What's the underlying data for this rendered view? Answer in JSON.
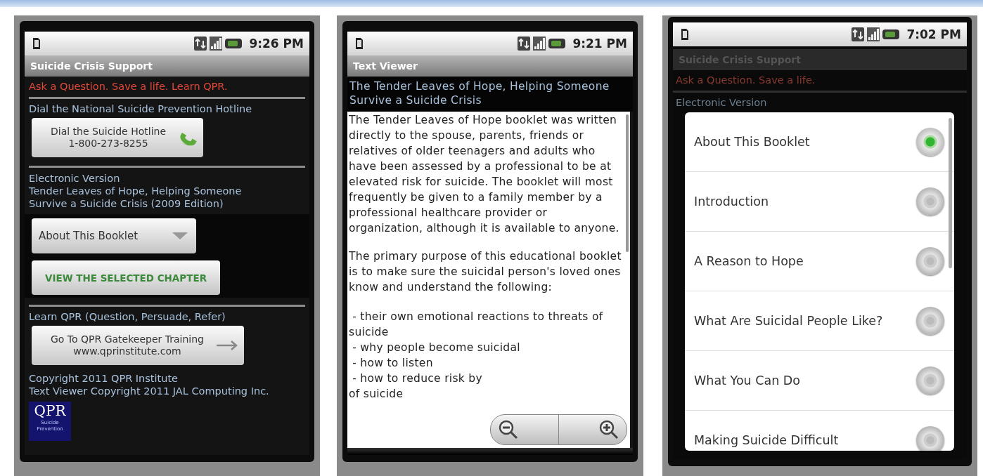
{
  "phones": [
    {
      "kind": "home",
      "time": "9:26 PM",
      "title": "Suicide Crisis Support",
      "tagline": "Ask a Question. Save a life. Learn QPR.",
      "hotline": {
        "label": "Dial the National Suicide Prevention Hotline",
        "button": [
          "Dial the Suicide Hotline",
          "1-800-273-8255"
        ]
      },
      "booklet": {
        "label_lines": [
          "Electronic Version",
          "Tender Leaves of Hope, Helping Someone",
          "Survive a Suicide Crisis (2009 Edition)"
        ],
        "chapter_spinner": "About This Booklet",
        "view_button": "VIEW THE SELECTED CHAPTER"
      },
      "training": {
        "label": "Learn QPR (Question, Persuade, Refer)",
        "button": [
          "Go To QPR Gatekeeper Training",
          "www.qprinstitute.com"
        ]
      },
      "copyright": [
        "Copyright 2011 QPR Institute",
        "Text Viewer Copyright 2011 JAL Computing Inc."
      ],
      "logo": {
        "title": "QPR",
        "subtitle": [
          "Suicide",
          "Prevention"
        ]
      }
    },
    {
      "kind": "viewer",
      "time": "9:21 PM",
      "title": "Text Viewer",
      "heading": "The Tender Leaves of Hope, Helping Someone Survive a Suicide Crisis",
      "paragraphs": [
        "The Tender Leaves of Hope booklet was written directly to the spouse, parents, friends or relatives of older teenagers and adults who have been assessed by a professional to be at elevated risk for suicide. The booklet will most frequently be given to a family member by a professional healthcare provider or organization, although it is available to anyone.",
        " The primary purpose of this educational booklet is to make sure the suicidal person's loved ones know and understand the following:"
      ],
      "list_lines": [
        " - their own emotional reactions to threats of",
        "suicide",
        " - why people become suicidal",
        " - how to listen",
        " - how to reduce risk by",
        "of suicide"
      ]
    },
    {
      "kind": "chooser",
      "time": "7:02 PM",
      "title": "Suicide Crisis Support",
      "tagline": "Ask a Question. Save a life.",
      "label": "Electronic Version",
      "options": [
        {
          "label": "About This Booklet",
          "selected": true
        },
        {
          "label": "Introduction",
          "selected": false
        },
        {
          "label": "A Reason to Hope",
          "selected": false
        },
        {
          "label": "What Are Suicidal People Like?",
          "selected": false
        },
        {
          "label": "What You Can Do",
          "selected": false
        },
        {
          "label": "Making Suicide Difficult",
          "selected": false
        }
      ]
    }
  ]
}
